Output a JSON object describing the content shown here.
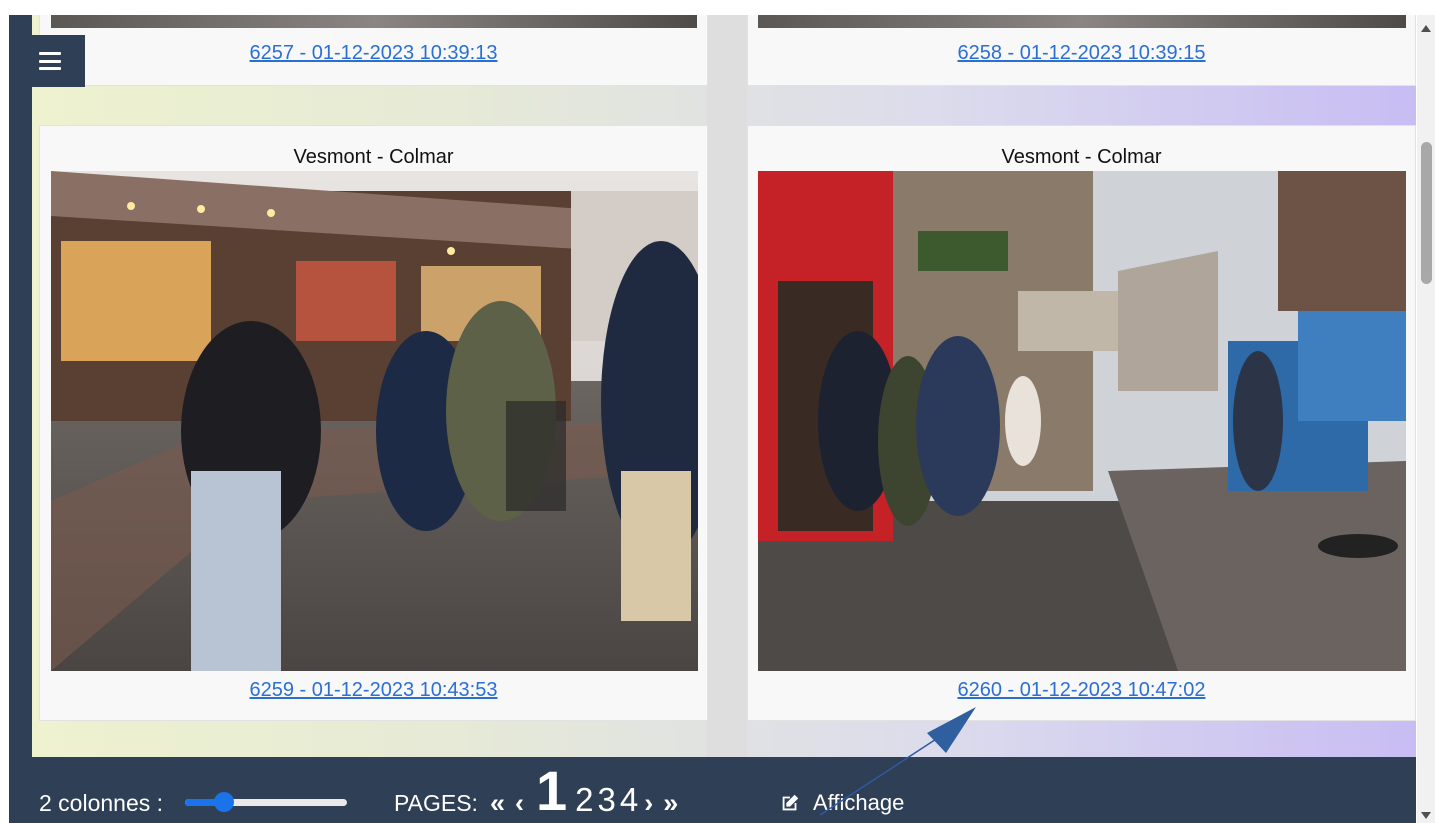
{
  "menu": {
    "icon": "hamburger-icon"
  },
  "gallery": {
    "top_row": [
      {
        "link": "6257 - 01-12-2023 10:39:13"
      },
      {
        "link": "6258 - 01-12-2023 10:39:15"
      }
    ],
    "photos": [
      {
        "title": "Vesmont - Colmar",
        "link": "6259 - 01-12-2023 10:43:53"
      },
      {
        "title": "Vesmont - Colmar",
        "link": "6260 - 01-12-2023 10:47:02"
      }
    ]
  },
  "toolbar": {
    "columns_label": "2 colonnes :",
    "columns_slider_fraction": 0.24,
    "pages_label": "PAGES:",
    "first_symbol": "«",
    "prev_symbol": "‹",
    "current_page": "1",
    "pages": [
      "2",
      "3",
      "4"
    ],
    "next_symbol": "›",
    "last_symbol": "»",
    "display_label": "Affichage",
    "display_icon": "edit-icon"
  },
  "colors": {
    "frame": "#2f3f55",
    "link": "#2a6fd6",
    "slider": "#1a73e8"
  }
}
